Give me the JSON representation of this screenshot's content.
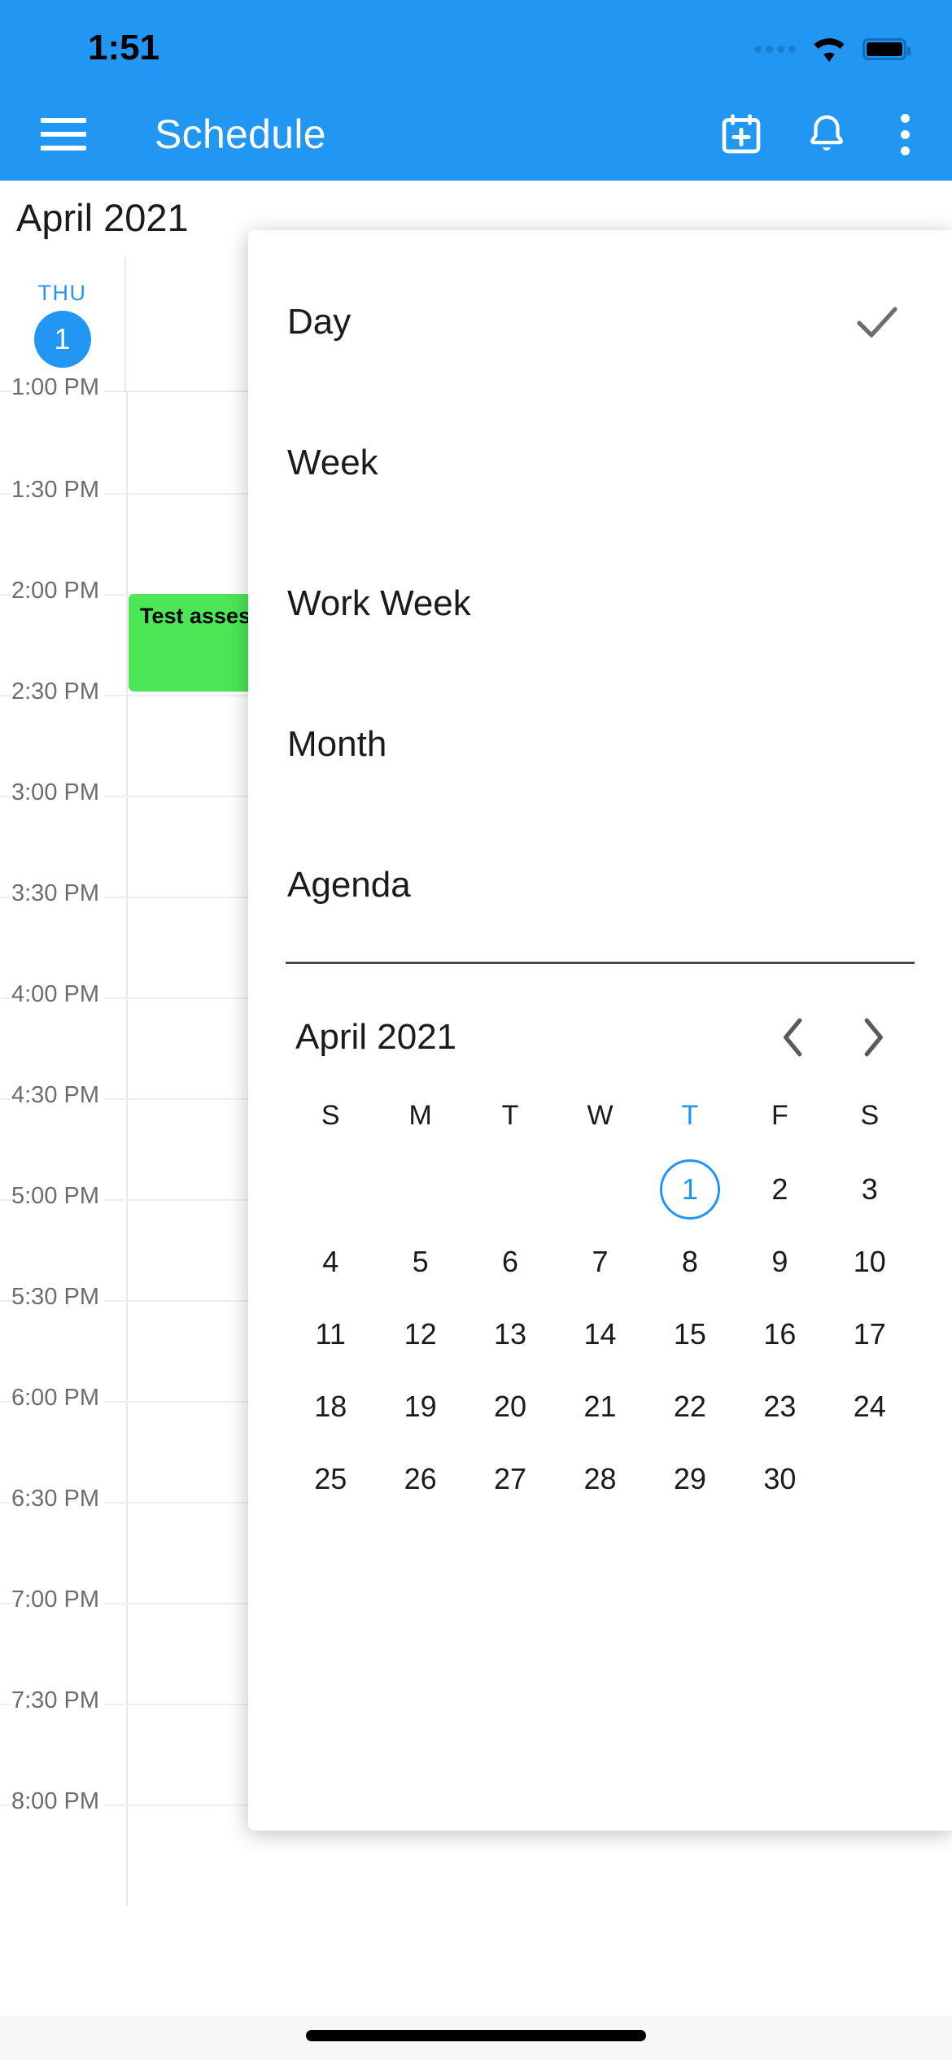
{
  "status_bar": {
    "time": "1:51",
    "icons": [
      "signal-dots-icon",
      "wifi-icon",
      "battery-icon"
    ]
  },
  "app_bar": {
    "title": "Schedule",
    "menu_icon": "hamburger-menu-icon",
    "actions": [
      {
        "name": "add-event-icon",
        "label": "Add event"
      },
      {
        "name": "notifications-bell-icon",
        "label": "Notifications"
      },
      {
        "name": "overflow-menu-icon",
        "label": "More options"
      }
    ]
  },
  "day_view": {
    "month_label": "April 2021",
    "day_header": {
      "weekday": "THU",
      "day_number": "1"
    },
    "time_slots": [
      "1:00 PM",
      "1:30 PM",
      "2:00 PM",
      "2:30 PM",
      "3:00 PM",
      "3:30 PM",
      "4:00 PM",
      "4:30 PM",
      "5:00 PM",
      "5:30 PM",
      "6:00 PM",
      "6:30 PM",
      "7:00 PM",
      "7:30 PM",
      "8:00 PM"
    ],
    "events": [
      {
        "title": "Test assessment",
        "start": "2:00 PM",
        "end": "2:30 PM",
        "color": "#4ce656"
      }
    ]
  },
  "view_menu": {
    "items": [
      {
        "label": "Day",
        "selected": true
      },
      {
        "label": "Week",
        "selected": false
      },
      {
        "label": "Work Week",
        "selected": false
      },
      {
        "label": "Month",
        "selected": false
      },
      {
        "label": "Agenda",
        "selected": false
      }
    ],
    "check_icon": "checkmark-icon"
  },
  "mini_calendar": {
    "title": "April 2021",
    "prev_icon": "chevron-left-icon",
    "next_icon": "chevron-right-icon",
    "weekday_headers": [
      "S",
      "M",
      "T",
      "W",
      "T",
      "F",
      "S"
    ],
    "highlighted_weekday_index": 4,
    "leading_blanks": 4,
    "days": [
      1,
      2,
      3,
      4,
      5,
      6,
      7,
      8,
      9,
      10,
      11,
      12,
      13,
      14,
      15,
      16,
      17,
      18,
      19,
      20,
      21,
      22,
      23,
      24,
      25,
      26,
      27,
      28,
      29,
      30
    ],
    "selected_day": 1
  },
  "colors": {
    "primary": "#2196f3",
    "event_green": "#4ce656",
    "text_dark": "#1b1b1b",
    "text_muted": "#6d6d6d"
  },
  "home_indicator": "home-indicator"
}
